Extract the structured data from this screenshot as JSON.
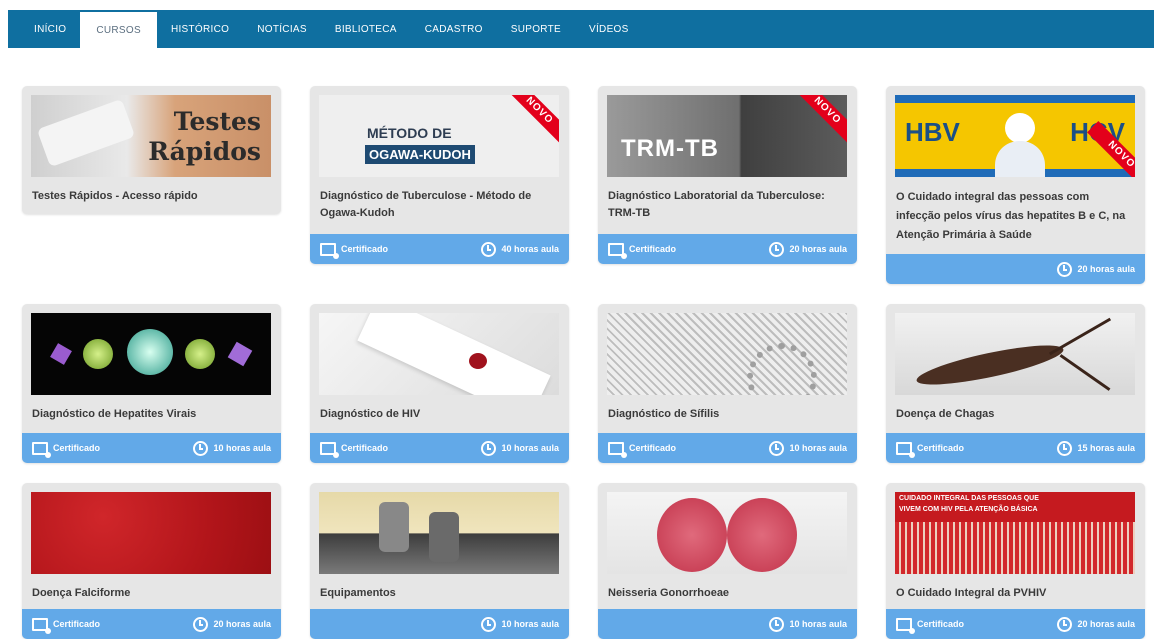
{
  "nav": {
    "items": [
      "INÍCIO",
      "CURSOS",
      "HISTÓRICO",
      "NOTÍCIAS",
      "BIBLIOTECA",
      "CADASTRO",
      "SUPORTE",
      "VÍDEOS"
    ],
    "active_index": 1
  },
  "labels": {
    "cert": "Certificado",
    "novo": "NOVO"
  },
  "cards": [
    {
      "title": "Testes Rápidos - Acesso rápido",
      "thumb_text": [
        "Testes",
        "Rápidos"
      ]
    },
    {
      "title": "Diagnóstico de Tuberculose - Método de Ogawa-Kudoh",
      "hours": "40 horas aula",
      "certificate": true,
      "novo": true,
      "thumb_text": [
        "MÉTODO DE",
        "OGAWA-KUDOH"
      ]
    },
    {
      "title": "Diagnóstico Laboratorial da Tuberculose: TRM-TB",
      "hours": "20 horas aula",
      "certificate": true,
      "novo": true,
      "thumb_text": [
        "TRM-TB"
      ]
    },
    {
      "title": "O Cuidado integral das pessoas com infecção pelos vírus das hepatites B e C, na Atenção Primária à Saúde",
      "hours": "20 horas aula",
      "certificate": false,
      "novo": true,
      "thumb_text": [
        "HBV",
        "HCV"
      ]
    },
    {
      "title": "Diagnóstico de Hepatites Virais",
      "hours": "10 horas aula",
      "certificate": true
    },
    {
      "title": "Diagnóstico de HIV",
      "hours": "10 horas aula",
      "certificate": true
    },
    {
      "title": "Diagnóstico de Sífilis",
      "hours": "10 horas aula",
      "certificate": true
    },
    {
      "title": "Doença de Chagas",
      "hours": "15 horas aula",
      "certificate": true
    },
    {
      "title": "Doença Falciforme",
      "hours": "20 horas aula",
      "certificate": true
    },
    {
      "title": "Equipamentos",
      "hours": "10 horas aula",
      "certificate": false
    },
    {
      "title": "Neisseria Gonorrhoeae",
      "hours": "10 horas aula",
      "certificate": false
    },
    {
      "title": "O Cuidado Integral da PVHIV",
      "hours": "20 horas aula",
      "certificate": true,
      "thumb_text": [
        "CUIDADO INTEGRAL DAS PESSOAS QUE",
        "VIVEM COM HIV PELA ATENÇÃO BÁSICA"
      ]
    }
  ],
  "colors": {
    "nav": "#0f6fa0",
    "footer": "#62a9e8",
    "card": "#e6e6e6",
    "novo": "#e3001b"
  }
}
